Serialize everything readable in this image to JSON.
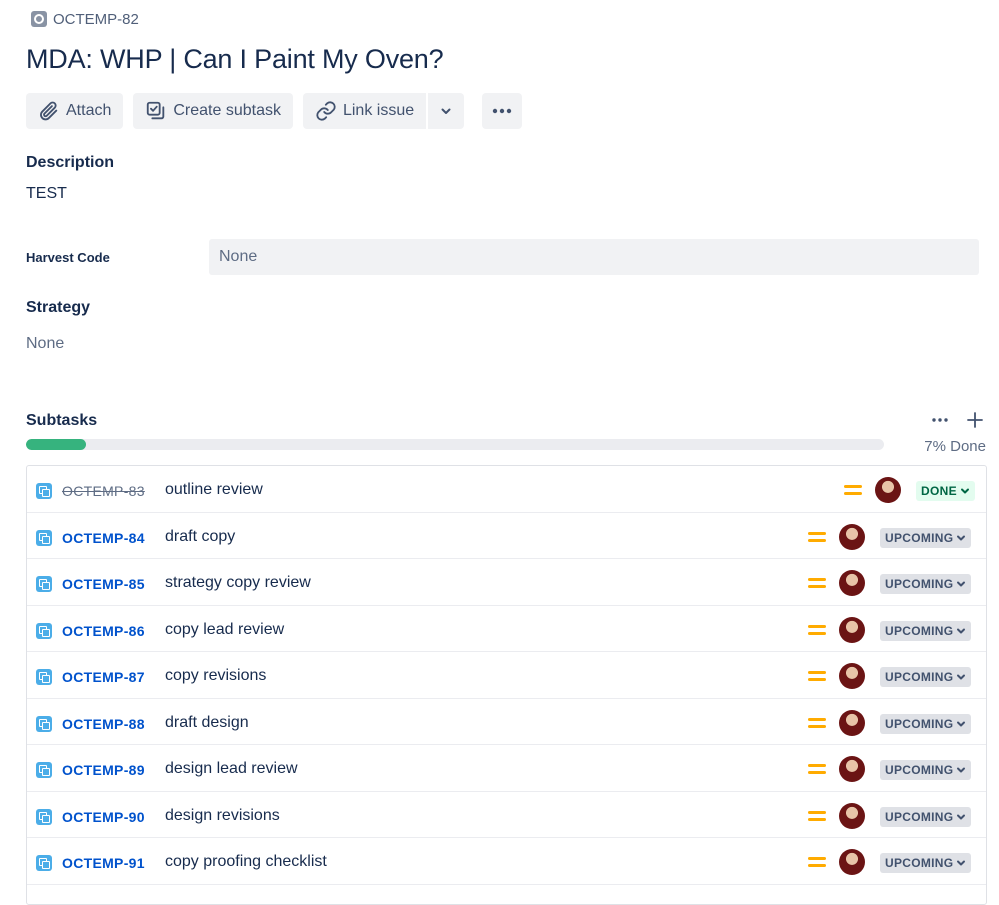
{
  "issue": {
    "key": "OCTEMP-82",
    "title": "MDA: WHP | Can I Paint My Oven?"
  },
  "toolbar": {
    "attach_label": "Attach",
    "create_subtask_label": "Create subtask",
    "link_issue_label": "Link issue"
  },
  "description": {
    "label": "Description",
    "text": "TEST"
  },
  "harvest_code": {
    "label": "Harvest Code",
    "value": "None"
  },
  "strategy": {
    "label": "Strategy",
    "value": "None"
  },
  "subtasks": {
    "label": "Subtasks",
    "progress_label": "7% Done",
    "progress_fraction": 0.07,
    "accent_color": "#36b37e",
    "items": [
      {
        "key": "OCTEMP-83",
        "summary": "outline review",
        "status": "DONE",
        "done": true
      },
      {
        "key": "OCTEMP-84",
        "summary": "draft copy",
        "status": "UPCOMING",
        "done": false
      },
      {
        "key": "OCTEMP-85",
        "summary": "strategy copy review",
        "status": "UPCOMING",
        "done": false
      },
      {
        "key": "OCTEMP-86",
        "summary": "copy lead review",
        "status": "UPCOMING",
        "done": false
      },
      {
        "key": "OCTEMP-87",
        "summary": "copy revisions",
        "status": "UPCOMING",
        "done": false
      },
      {
        "key": "OCTEMP-88",
        "summary": "draft design",
        "status": "UPCOMING",
        "done": false
      },
      {
        "key": "OCTEMP-89",
        "summary": "design lead review",
        "status": "UPCOMING",
        "done": false
      },
      {
        "key": "OCTEMP-90",
        "summary": "design revisions",
        "status": "UPCOMING",
        "done": false
      },
      {
        "key": "OCTEMP-91",
        "summary": "copy proofing checklist",
        "status": "UPCOMING",
        "done": false
      }
    ]
  }
}
